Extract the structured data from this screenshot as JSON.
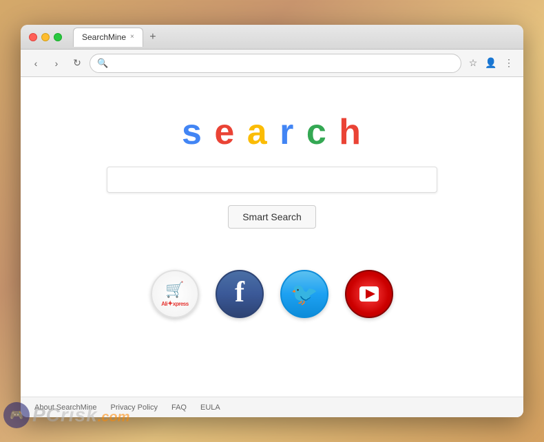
{
  "browser": {
    "tab_title": "SearchMine",
    "tab_close": "×",
    "tab_new": "+",
    "nav": {
      "back_label": "‹",
      "forward_label": "›",
      "refresh_label": "↻",
      "address_placeholder": "",
      "address_value": "",
      "bookmark_label": "☆",
      "profile_label": "👤",
      "menu_label": "⋮"
    }
  },
  "page": {
    "logo": {
      "s": "s",
      "e": "e",
      "a": "a",
      "r": "r",
      "c": "c",
      "h": "h"
    },
    "search_placeholder": "",
    "smart_search_label": "Smart Search",
    "shortcuts": [
      {
        "id": "aliexpress",
        "label": "AliExpress"
      },
      {
        "id": "facebook",
        "label": "Facebook"
      },
      {
        "id": "twitter",
        "label": "Twitter"
      },
      {
        "id": "youtube",
        "label": "YouTube"
      }
    ],
    "footer_links": [
      "About SearchMine",
      "Privacy Policy",
      "FAQ",
      "EULA"
    ]
  },
  "watermark": {
    "pcrisk": "PC",
    "text": "risk",
    "dotcom": ".com"
  }
}
